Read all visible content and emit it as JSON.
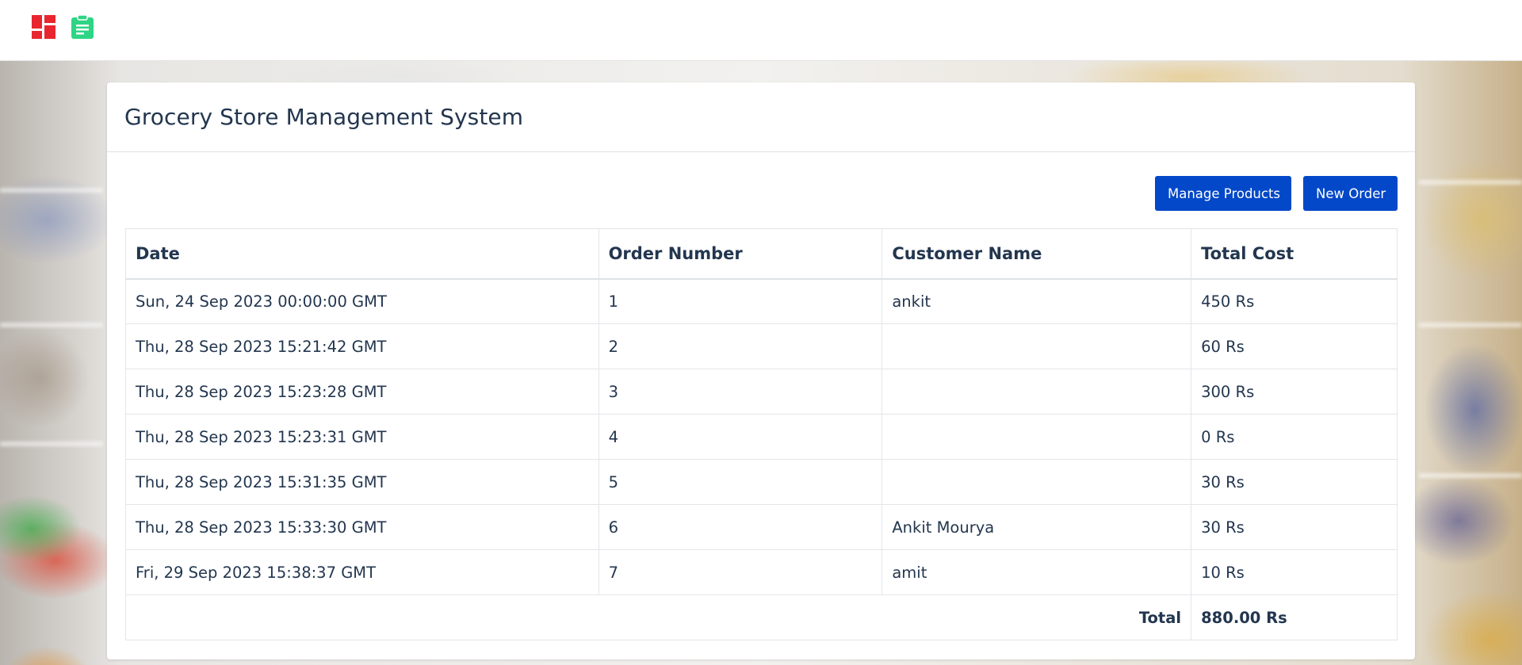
{
  "nav": {
    "icons": [
      "dashboard-icon",
      "order-clipboard-icon"
    ],
    "colors": {
      "dashboard": "#e8262f",
      "order": "#2ed584"
    }
  },
  "header": {
    "title": "Grocery Store Management System"
  },
  "toolbar": {
    "manage_products_label": "Manage Products",
    "new_order_label": "New Order",
    "button_color": "#0248c8"
  },
  "table": {
    "columns": [
      "Date",
      "Order Number",
      "Customer Name",
      "Total Cost"
    ],
    "rows": [
      {
        "date": "Sun, 24 Sep 2023 00:00:00 GMT",
        "order_number": "1",
        "customer_name": "ankit",
        "total_cost": "450 Rs"
      },
      {
        "date": "Thu, 28 Sep 2023 15:21:42 GMT",
        "order_number": "2",
        "customer_name": "",
        "total_cost": "60 Rs"
      },
      {
        "date": "Thu, 28 Sep 2023 15:23:28 GMT",
        "order_number": "3",
        "customer_name": "",
        "total_cost": "300 Rs"
      },
      {
        "date": "Thu, 28 Sep 2023 15:23:31 GMT",
        "order_number": "4",
        "customer_name": "",
        "total_cost": "0 Rs"
      },
      {
        "date": "Thu, 28 Sep 2023 15:31:35 GMT",
        "order_number": "5",
        "customer_name": "",
        "total_cost": "30 Rs"
      },
      {
        "date": "Thu, 28 Sep 2023 15:33:30 GMT",
        "order_number": "6",
        "customer_name": "Ankit Mourya",
        "total_cost": "30 Rs"
      },
      {
        "date": "Fri, 29 Sep 2023 15:38:37 GMT",
        "order_number": "7",
        "customer_name": "amit",
        "total_cost": "10 Rs"
      }
    ],
    "footer": {
      "label": "Total",
      "value": "880.00 Rs"
    }
  }
}
